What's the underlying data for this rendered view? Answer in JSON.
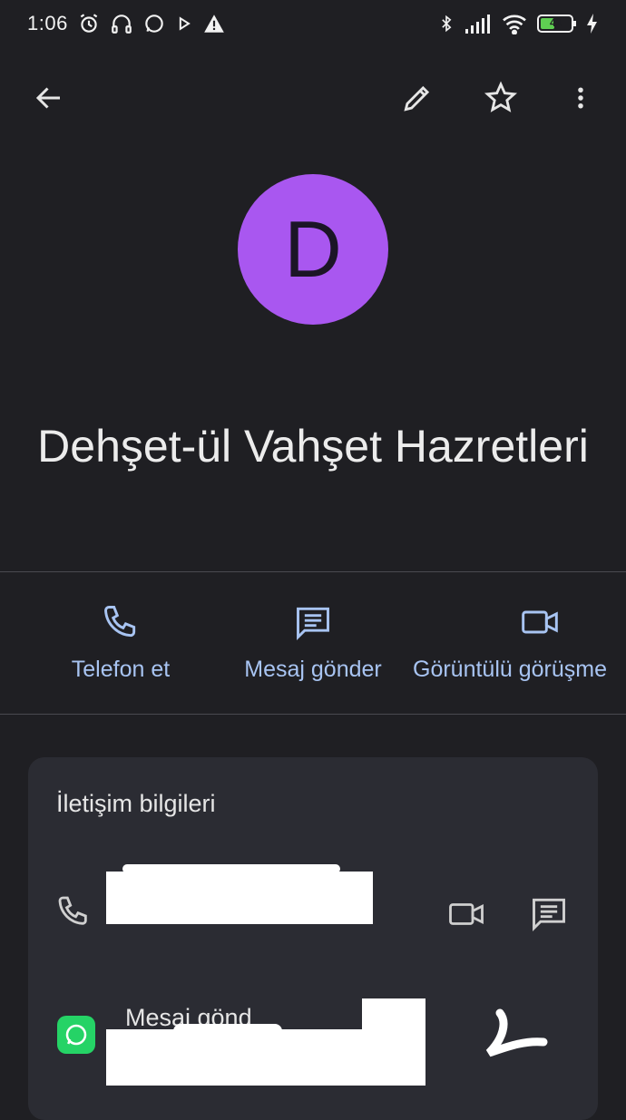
{
  "status_bar": {
    "time": "1:06",
    "battery": "41"
  },
  "toolbar": {
    "back": "back-arrow-icon",
    "edit": "pencil-icon",
    "favorite": "star-outline-icon",
    "more": "more-vertical-icon"
  },
  "contact": {
    "initial": "D",
    "name": "Dehşet-ül Vahşet Hazretleri",
    "avatar_color": "#a957f0"
  },
  "actions": [
    {
      "label": "Telefon et",
      "icon": "phone-icon"
    },
    {
      "label": "Mesaj gönder",
      "icon": "message-icon"
    },
    {
      "label": "Görüntülü görüşme",
      "icon": "video-icon"
    }
  ],
  "contact_info": {
    "title": "İletişim bilgileri",
    "whatsapp_label": "Mesaj gönd"
  },
  "colors": {
    "background": "#1f1f23",
    "card": "#2b2c33",
    "accent": "#a8c4f2"
  }
}
